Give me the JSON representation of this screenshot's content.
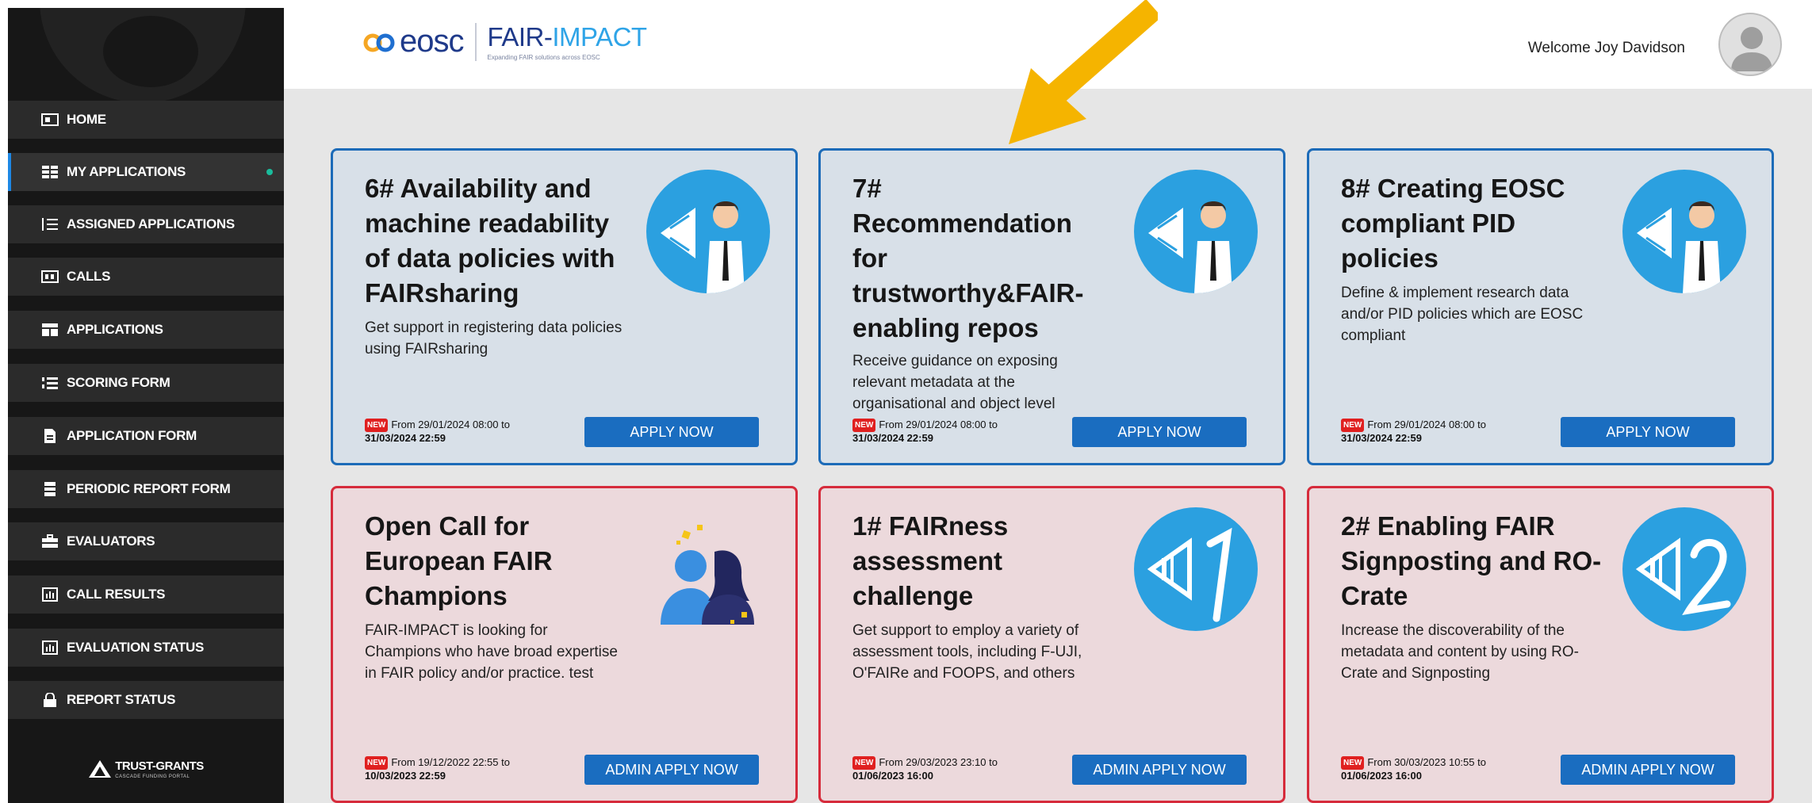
{
  "header": {
    "logo_eosc": "eosc",
    "logo_fair": "FAIR-",
    "logo_impact": "IMPACT",
    "logo_sub": "Expanding FAIR solutions across EOSC",
    "welcome": "Welcome Joy Davidson"
  },
  "sidebar": {
    "items": [
      {
        "label": "HOME",
        "icon": "home-icon"
      },
      {
        "label": "MY APPLICATIONS",
        "icon": "grid-icon",
        "active": true
      },
      {
        "label": "ASSIGNED APPLICATIONS",
        "icon": "list-indent-icon"
      },
      {
        "label": "CALLS",
        "icon": "calendar-icon"
      },
      {
        "label": "APPLICATIONS",
        "icon": "layout-icon"
      },
      {
        "label": "SCORING FORM",
        "icon": "numbered-list-icon"
      },
      {
        "label": "APPLICATION FORM",
        "icon": "document-icon"
      },
      {
        "label": "PERIODIC REPORT FORM",
        "icon": "periodic-icon"
      },
      {
        "label": "EVALUATORS",
        "icon": "briefcase-icon"
      },
      {
        "label": "CALL RESULTS",
        "icon": "bar-chart-icon"
      },
      {
        "label": "EVALUATION STATUS",
        "icon": "bar-chart-icon"
      },
      {
        "label": "REPORT STATUS",
        "icon": "lock-icon"
      }
    ],
    "brand": "TRUST-GRANTS",
    "brand_sub": "CASCADE FUNDING PORTAL"
  },
  "cards": [
    {
      "title": "6# Availability and machine readability of data policies with FAIRsharing",
      "desc": "Get support in registering data policies using FAIRsharing",
      "badge": "NEW",
      "dates_line1": "From 29/01/2024 08:00 to",
      "dates_line2": "31/03/2024 22:59",
      "button": "APPLY NOW"
    },
    {
      "title": "7# Recommendation for trustworthy&FAIR-enabling repos",
      "desc": "Receive guidance on exposing relevant metadata at the organisational and object level",
      "badge": "NEW",
      "dates_line1": "From 29/01/2024 08:00 to",
      "dates_line2": "31/03/2024 22:59",
      "button": "APPLY NOW"
    },
    {
      "title": "8# Creating EOSC compliant PID policies",
      "desc": "Define & implement research data and/or PID policies which are EOSC compliant",
      "badge": "NEW",
      "dates_line1": "From 29/01/2024 08:00 to",
      "dates_line2": "31/03/2024 22:59",
      "button": "APPLY NOW"
    },
    {
      "title": "Open Call for European FAIR Champions",
      "desc": "FAIR-IMPACT is looking for Champions who have broad expertise in FAIR policy and/or practice. test",
      "badge": "NEW",
      "dates_line1": "From 19/12/2022 22:55 to",
      "dates_line2": "10/03/2023 22:59",
      "button": "ADMIN APPLY NOW"
    },
    {
      "title": "1# FAIRness assessment challenge",
      "desc": "Get support to employ a variety of assessment tools, including F-UJI, O'FAIRe and FOOPS, and others",
      "badge": "NEW",
      "dates_line1": "From 29/03/2023 23:10 to",
      "dates_line2": "01/06/2023 16:00",
      "button": "ADMIN APPLY NOW"
    },
    {
      "title": "2# Enabling FAIR Signposting and RO-Crate",
      "desc": "Increase the discoverability of the metadata and content by using RO-Crate and Signposting",
      "badge": "NEW",
      "dates_line1": "From 30/03/2023 10:55 to",
      "dates_line2": "01/06/2023 16:00",
      "button": "ADMIN APPLY NOW"
    }
  ],
  "colors": {
    "blue_border": "#1c6bb8",
    "red_border": "#d62b3b",
    "button": "#1a6dc0",
    "arrow": "#f5b400"
  }
}
